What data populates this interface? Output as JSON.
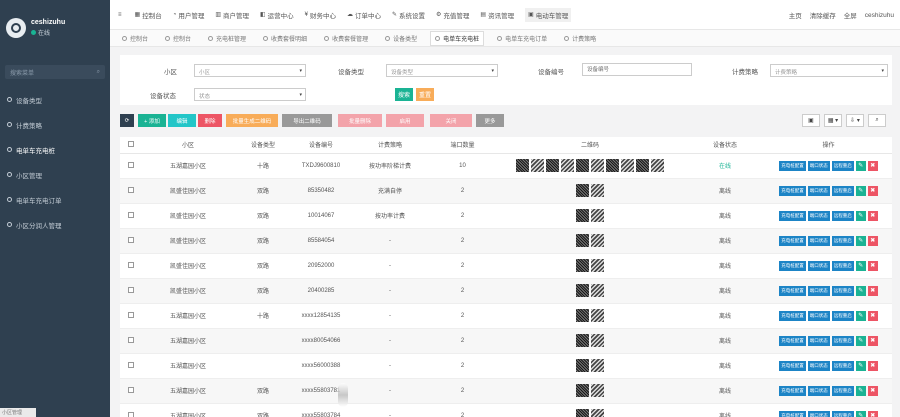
{
  "user": {
    "name": "ceshizuhu",
    "status": "在线"
  },
  "sidebar": {
    "search_placeholder": "搜索菜单",
    "items": [
      {
        "label": "设备类型"
      },
      {
        "label": "计费策略"
      },
      {
        "label": "电单车充电桩"
      },
      {
        "label": "小区管理"
      },
      {
        "label": "电单车充电订单"
      },
      {
        "label": "小区分润人管理"
      }
    ],
    "footer": "小区管理"
  },
  "topnav": {
    "items": [
      "控制台",
      "用户管理",
      "商户管理",
      "运营中心",
      "财务中心",
      "订单中心",
      "系统设置",
      "充值管理",
      "资讯管理",
      "电动车管理"
    ],
    "right": [
      "主页",
      "清除缓存",
      "全屏",
      "ceshizuhu"
    ]
  },
  "tabs": [
    "控制台",
    "控制台",
    "充电桩管理",
    "收费套餐明细",
    "收费套餐管理",
    "设备类型",
    "电单车充电桩",
    "电单车充电订单",
    "计费策略"
  ],
  "filters": {
    "community_label": "小区",
    "community_value": "小区",
    "type_label": "设备类型",
    "type_placeholder": "设备类型",
    "serial_label": "设备编号",
    "serial_placeholder": "设备编号",
    "policy_label": "计费策略",
    "policy_placeholder": "计费策略",
    "status_label": "设备状态",
    "status_value": "状态",
    "search_btn": "搜索",
    "reset_btn": "重置"
  },
  "toolbar": {
    "buttons": [
      "",
      "+ 添加",
      "编辑",
      "删除",
      "批量生成二维码",
      "导出二维码",
      "批量删除",
      "启用",
      "关闭",
      "更多"
    ],
    "right": [
      "▣",
      "▦ ▾",
      "⇩ ▾",
      "⌕"
    ]
  },
  "table": {
    "columns": [
      "",
      "小区",
      "设备类型",
      "设备编号",
      "计费策略",
      "端口数量",
      "二维码",
      "设备状态",
      "操作"
    ],
    "op_labels": [
      "充电桩配置",
      "端口状态",
      "远程重启",
      "✎",
      "✖"
    ],
    "rows": [
      {
        "community": "五湖嘉园小区",
        "type": "十路",
        "serial": "TXDJ9600810",
        "policy": "按功率阶梯计费",
        "ports": "10",
        "qr": 10,
        "status": "在线"
      },
      {
        "community": "凯盛佳园小区",
        "type": "双路",
        "serial": "85350482",
        "policy": "充满自停",
        "ports": "2",
        "qr": 2,
        "status": "离线"
      },
      {
        "community": "凯盛佳园小区",
        "type": "双路",
        "serial": "10014067",
        "policy": "按功率计费",
        "ports": "2",
        "qr": 2,
        "status": "离线"
      },
      {
        "community": "凯盛佳园小区",
        "type": "双路",
        "serial": "85584054",
        "policy": "-",
        "ports": "2",
        "qr": 2,
        "status": "离线"
      },
      {
        "community": "凯盛佳园小区",
        "type": "双路",
        "serial": "20952000",
        "policy": "-",
        "ports": "2",
        "qr": 2,
        "status": "离线"
      },
      {
        "community": "凯盛佳园小区",
        "type": "双路",
        "serial": "20400285",
        "policy": "-",
        "ports": "2",
        "qr": 2,
        "status": "离线"
      },
      {
        "community": "五湖嘉园小区",
        "type": "十路",
        "serial": "xxxx12854135",
        "policy": "-",
        "ports": "2",
        "qr": 2,
        "status": "离线"
      },
      {
        "community": "五湖嘉园小区",
        "type": "",
        "serial": "xxxx80054066",
        "policy": "-",
        "ports": "2",
        "qr": 2,
        "status": "离线"
      },
      {
        "community": "五湖嘉园小区",
        "type": "",
        "serial": "xxxx56000388",
        "policy": "-",
        "ports": "2",
        "qr": 2,
        "status": "离线"
      },
      {
        "community": "五湖嘉园小区",
        "type": "双路",
        "serial": "xxxx55803781",
        "policy": "-",
        "ports": "2",
        "qr": 2,
        "status": "离线"
      },
      {
        "community": "五湖嘉园小区",
        "type": "双路",
        "serial": "xxxx55803784",
        "policy": "-",
        "ports": "2",
        "qr": 2,
        "status": "离线"
      }
    ]
  },
  "colors": {
    "sidebar": "#2f4050",
    "primary": "#1ab394",
    "blue": "#1c84c6",
    "danger": "#ed5565",
    "warn": "#f8ac59",
    "info": "#23c6c8"
  }
}
